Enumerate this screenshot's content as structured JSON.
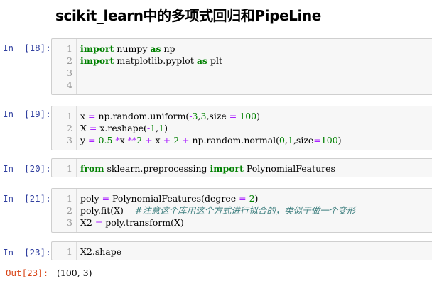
{
  "notebook": {
    "title": "scikit_learn中的多项式回归和PipeLine",
    "cells": [
      {
        "prompt": "In  [18]:",
        "line_numbers": [
          "1",
          "2",
          "3",
          "4"
        ],
        "lines": [
          [
            {
              "t": "import",
              "c": "kw"
            },
            {
              "t": " numpy "
            },
            {
              "t": "as",
              "c": "kw"
            },
            {
              "t": " np"
            }
          ],
          [
            {
              "t": "import",
              "c": "kw"
            },
            {
              "t": " matplotlib.pyplot "
            },
            {
              "t": "as",
              "c": "kw"
            },
            {
              "t": " plt"
            }
          ],
          [],
          []
        ]
      },
      {
        "prompt": "In  [19]:",
        "line_numbers": [
          "1",
          "2",
          "3"
        ],
        "lines": [
          [
            {
              "t": "x "
            },
            {
              "t": "=",
              "c": "op"
            },
            {
              "t": " np.random.uniform("
            },
            {
              "t": "-",
              "c": "op"
            },
            {
              "t": "3",
              "c": "num"
            },
            {
              "t": ","
            },
            {
              "t": "3",
              "c": "num"
            },
            {
              "t": ",size "
            },
            {
              "t": "=",
              "c": "op"
            },
            {
              "t": " "
            },
            {
              "t": "100",
              "c": "num"
            },
            {
              "t": ")"
            }
          ],
          [
            {
              "t": "X "
            },
            {
              "t": "=",
              "c": "op"
            },
            {
              "t": " x.reshape("
            },
            {
              "t": "-",
              "c": "op"
            },
            {
              "t": "1",
              "c": "num"
            },
            {
              "t": ","
            },
            {
              "t": "1",
              "c": "num"
            },
            {
              "t": ")"
            }
          ],
          [
            {
              "t": "y "
            },
            {
              "t": "=",
              "c": "op"
            },
            {
              "t": " "
            },
            {
              "t": "0.5",
              "c": "num"
            },
            {
              "t": " "
            },
            {
              "t": "*",
              "c": "op"
            },
            {
              "t": "x "
            },
            {
              "t": "**",
              "c": "op"
            },
            {
              "t": "2",
              "c": "num"
            },
            {
              "t": " "
            },
            {
              "t": "+",
              "c": "op"
            },
            {
              "t": " x "
            },
            {
              "t": "+",
              "c": "op"
            },
            {
              "t": " "
            },
            {
              "t": "2",
              "c": "num"
            },
            {
              "t": " "
            },
            {
              "t": "+",
              "c": "op"
            },
            {
              "t": " np.random.normal("
            },
            {
              "t": "0",
              "c": "num"
            },
            {
              "t": ","
            },
            {
              "t": "1",
              "c": "num"
            },
            {
              "t": ",size"
            },
            {
              "t": "=",
              "c": "op"
            },
            {
              "t": "100",
              "c": "num"
            },
            {
              "t": ")"
            }
          ]
        ]
      },
      {
        "prompt": "In  [20]:",
        "line_numbers": [
          "1"
        ],
        "lines": [
          [
            {
              "t": "from",
              "c": "kw"
            },
            {
              "t": " sklearn.preprocessing "
            },
            {
              "t": "import",
              "c": "kw"
            },
            {
              "t": " PolynomialFeatures"
            }
          ]
        ]
      },
      {
        "prompt": "In  [21]:",
        "line_numbers": [
          "1",
          "2",
          "3"
        ],
        "lines": [
          [
            {
              "t": "poly "
            },
            {
              "t": "=",
              "c": "op"
            },
            {
              "t": " PolynomialFeatures(degree "
            },
            {
              "t": "=",
              "c": "op"
            },
            {
              "t": " "
            },
            {
              "t": "2",
              "c": "num"
            },
            {
              "t": ")"
            }
          ],
          [
            {
              "t": "poly.fit(X)    "
            },
            {
              "t": "#注意这个库用这个方式进行拟合的，类似于做一个变形",
              "c": "cm"
            }
          ],
          [
            {
              "t": "X2 "
            },
            {
              "t": "=",
              "c": "op"
            },
            {
              "t": " poly.transform(X)"
            }
          ]
        ]
      },
      {
        "prompt": "In  [23]:",
        "line_numbers": [
          "1"
        ],
        "lines": [
          [
            {
              "t": "X2.shape"
            }
          ]
        ]
      }
    ],
    "output_prompt": "Out[23]:",
    "output_value": "(100, 3)"
  },
  "colors": {
    "in_prompt": "#303f9f",
    "out_prompt": "#d84315",
    "keyword": "#008000",
    "operator": "#aa22ff",
    "comment": "#408080",
    "cell_bg": "#f7f7f7",
    "cell_border": "#cfcfcf"
  }
}
